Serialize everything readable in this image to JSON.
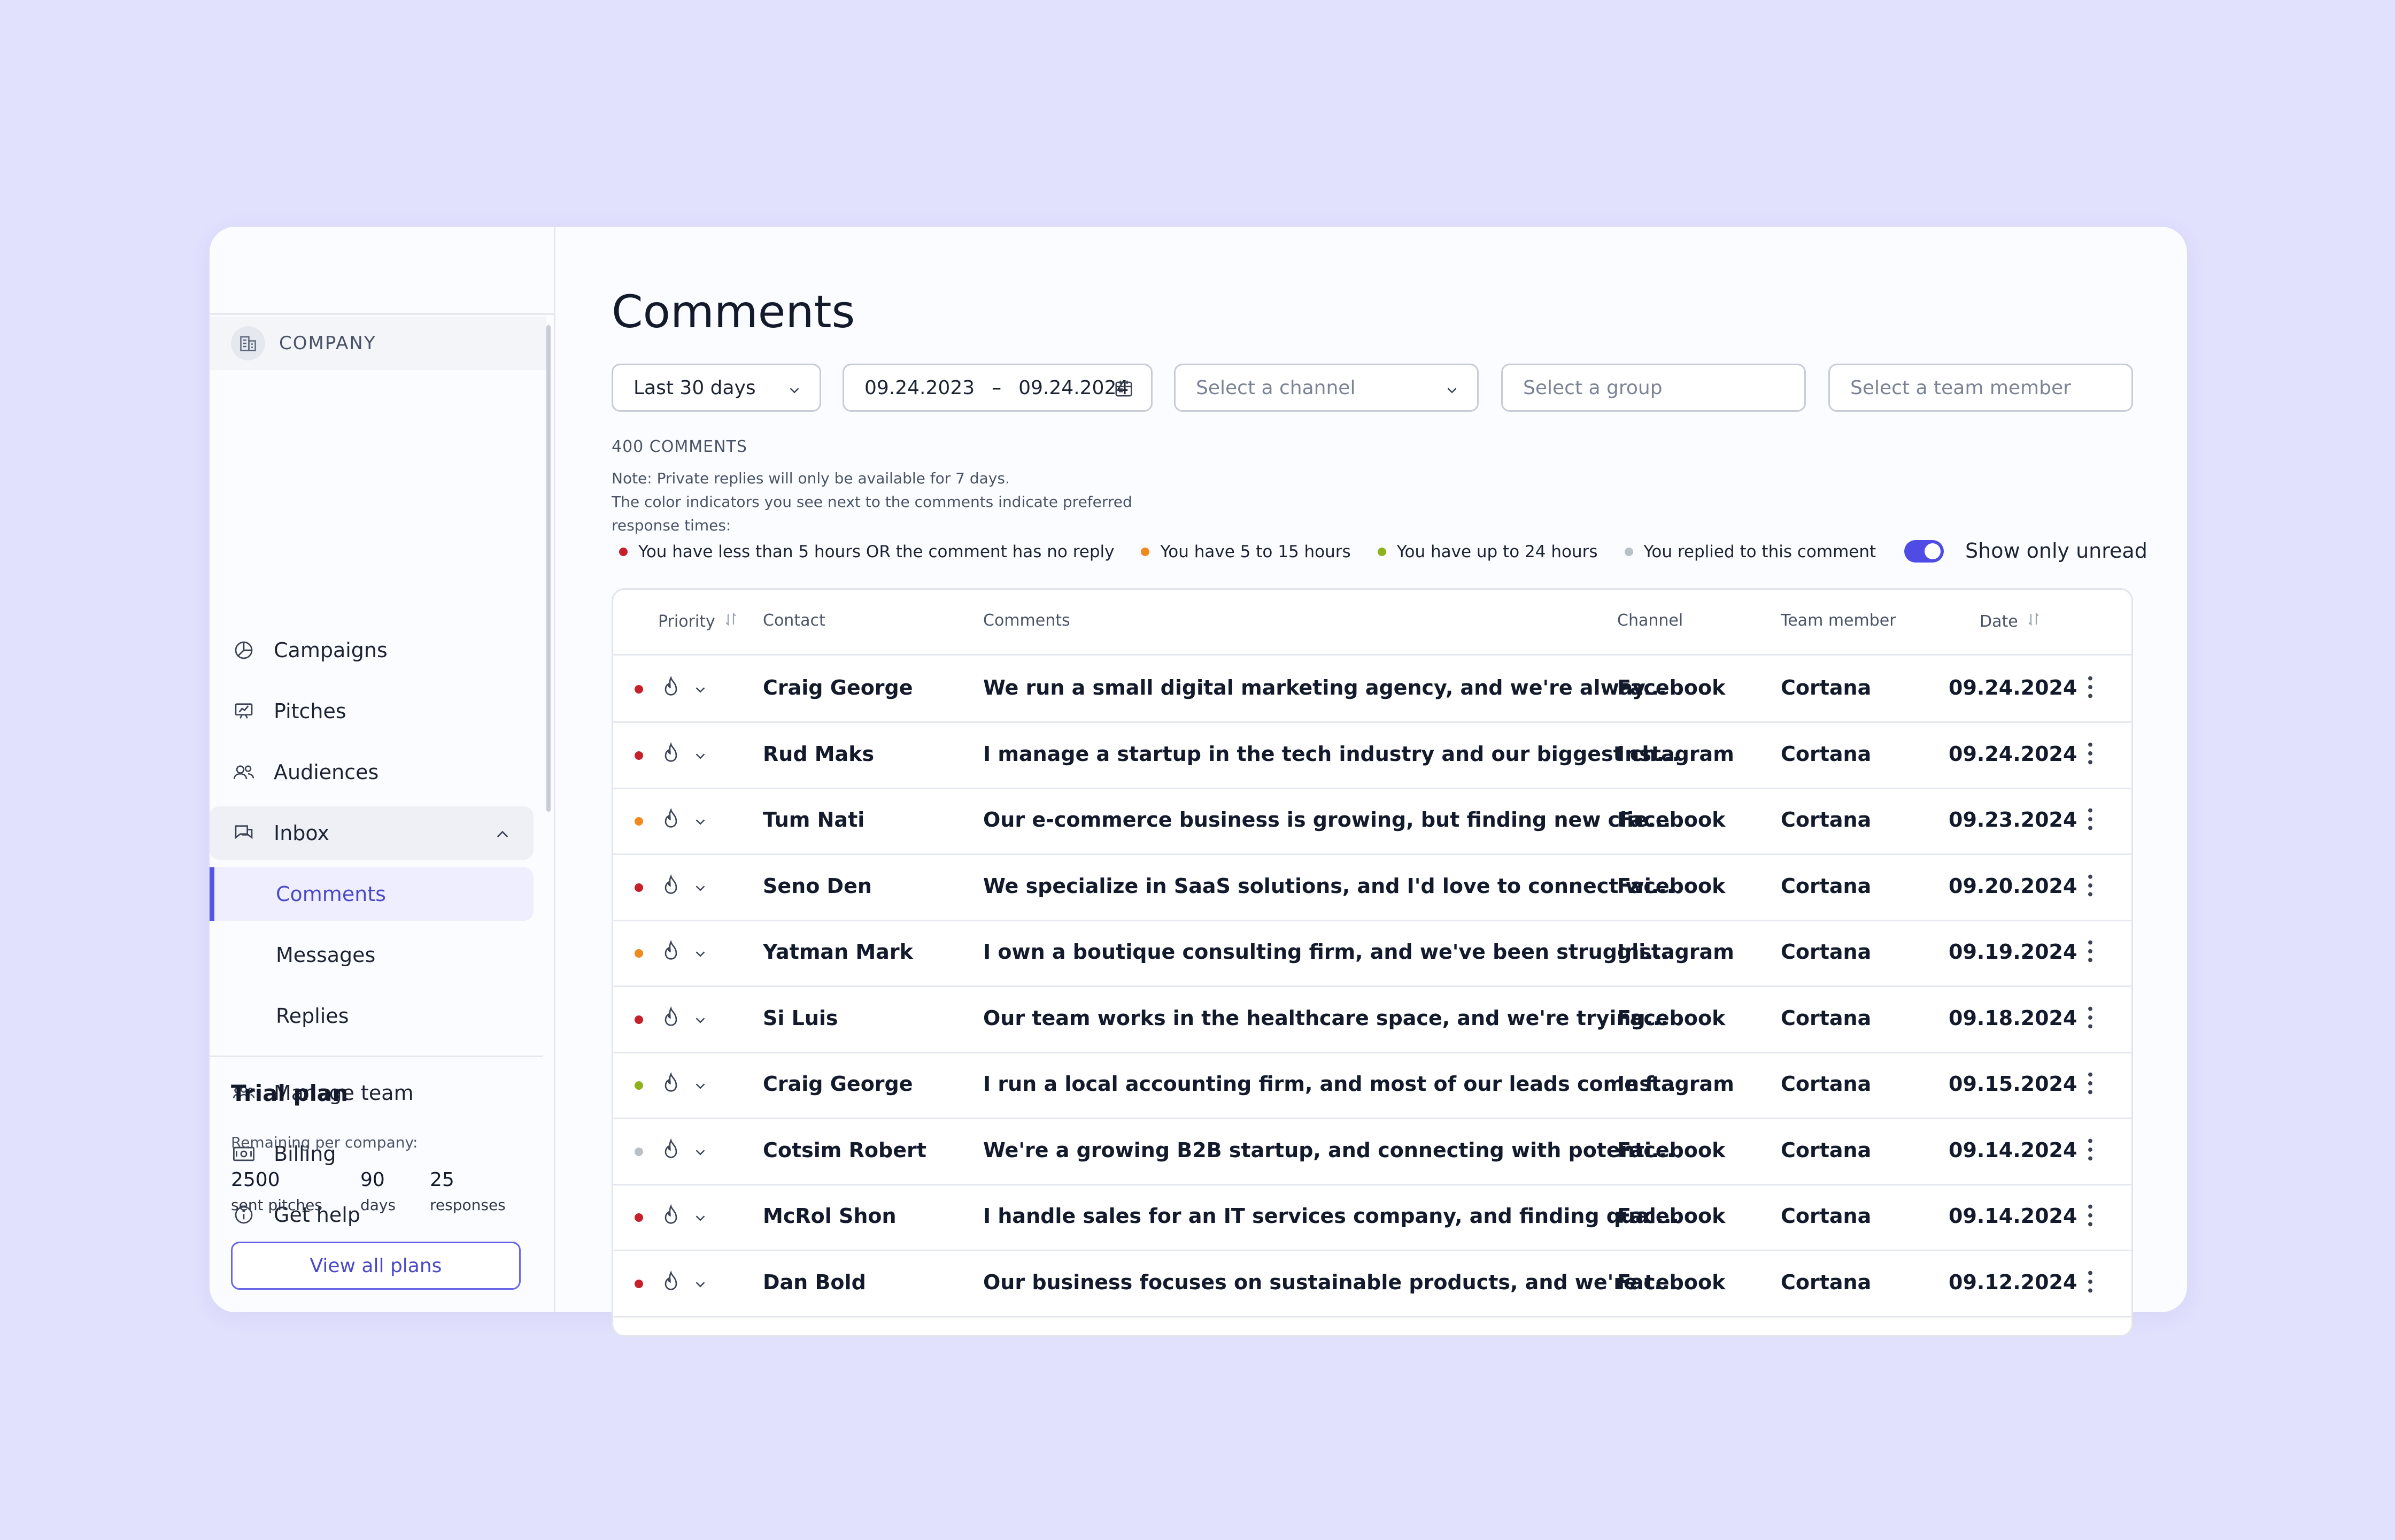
{
  "sidebar": {
    "company_label": "COMPANY",
    "nav": {
      "campaigns": "Campaigns",
      "pitches": "Pitches",
      "audiences": "Audiences",
      "inbox": "Inbox",
      "comments": "Comments",
      "messages": "Messages",
      "replies": "Replies",
      "manage_team": "Manage team",
      "billing": "Billing",
      "get_help": "Get help"
    },
    "plan": {
      "title": "Trial plan",
      "subtitle": "Remaining per company:",
      "stats": [
        {
          "value": "2500",
          "label": "sent pitches"
        },
        {
          "value": "90",
          "label": "days"
        },
        {
          "value": "25",
          "label": "responses"
        }
      ],
      "button": "View all plans"
    }
  },
  "main": {
    "title": "Comments",
    "filters": {
      "period": "Last 30 days",
      "date_from": "09.24.2023",
      "date_sep": "–",
      "date_to": "09.24.2024",
      "channel_placeholder": "Select a channel",
      "group_placeholder": "Select a group",
      "member_placeholder": "Select a team member"
    },
    "count": "400 COMMENTS",
    "note_line1": "Note: Private replies will only be available for 7 days.",
    "note_line2": "The color indicators you see next to the comments indicate preferred",
    "note_line3": "response times:",
    "legend": [
      {
        "label": "You have less than 5 hours OR the comment has no reply",
        "color": "#c6202b"
      },
      {
        "label": "You have 5 to 15 hours",
        "color": "#f08a1c"
      },
      {
        "label": "You have up to 24 hours",
        "color": "#8fb21c"
      },
      {
        "label": "You replied to this comment",
        "color": "#b9c1c6"
      }
    ],
    "toggle_label": "Show only unread",
    "toggle_on": true,
    "table": {
      "headers": {
        "priority": "Priority",
        "contact": "Contact",
        "comments": "Comments",
        "channel": "Channel",
        "team_member": "Team member",
        "date": "Date"
      },
      "rows": [
        {
          "status": "#c6202b",
          "contact": "Craig George",
          "comment": "We run a small digital marketing agency, and we're alway...",
          "channel": "Facebook",
          "member": "Cortana",
          "date": "09.24.2024"
        },
        {
          "status": "#c6202b",
          "contact": "Rud Maks",
          "comment": "I manage a startup in the tech industry and our biggest ch...",
          "channel": "Instagram",
          "member": "Cortana",
          "date": "09.24.2024"
        },
        {
          "status": "#f08a1c",
          "contact": "Tum Nati",
          "comment": "Our e-commerce business is growing, but finding new clie...",
          "channel": "Facebook",
          "member": "Cortana",
          "date": "09.23.2024"
        },
        {
          "status": "#c6202b",
          "contact": "Seno Den",
          "comment": "We specialize in SaaS solutions, and I'd love to connect wi...",
          "channel": "Facebook",
          "member": "Cortana",
          "date": "09.20.2024"
        },
        {
          "status": "#f08a1c",
          "contact": "Yatman Mark",
          "comment": "I own a boutique consulting firm, and we've been struggli...",
          "channel": "Instagram",
          "member": "Cortana",
          "date": "09.19.2024"
        },
        {
          "status": "#c6202b",
          "contact": "Si Luis",
          "comment": "Our team works in the healthcare space, and we're trying...",
          "channel": "Facebook",
          "member": "Cortana",
          "date": "09.18.2024"
        },
        {
          "status": "#8fb21c",
          "contact": "Craig George",
          "comment": "I run a local accounting firm, and most of our leads come f...",
          "channel": "Instagram",
          "member": "Cortana",
          "date": "09.15.2024"
        },
        {
          "status": "#b9c1c6",
          "contact": "Cotsim Robert",
          "comment": "We're a growing B2B startup, and connecting with potenti...",
          "channel": "Facebook",
          "member": "Cortana",
          "date": "09.14.2024"
        },
        {
          "status": "#c6202b",
          "contact": "McRol Shon",
          "comment": "I handle sales for an IT services company, and finding qual...",
          "channel": "Facebook",
          "member": "Cortana",
          "date": "09.14.2024"
        },
        {
          "status": "#c6202b",
          "contact": "Dan Bold",
          "comment": "Our business focuses on sustainable products, and we're t...",
          "channel": "Facebook",
          "member": "Cortana",
          "date": "09.12.2024"
        }
      ]
    },
    "colors": {
      "accent": "#5552e8",
      "active_bg": "#efeefe"
    }
  }
}
